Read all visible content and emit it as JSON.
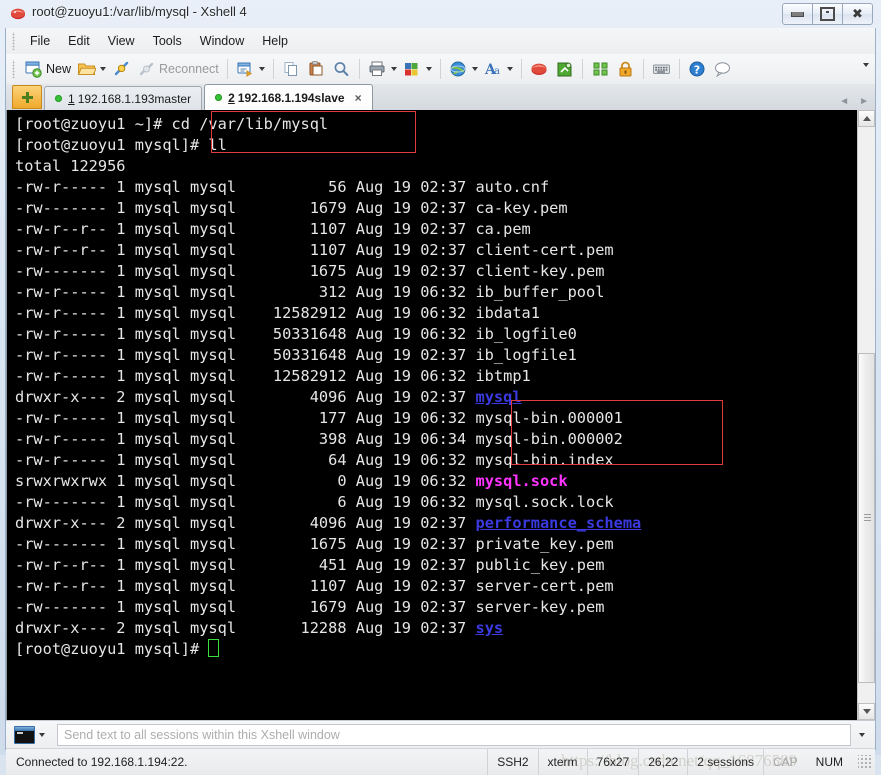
{
  "window": {
    "title": "root@zuoyu1:/var/lib/mysql - Xshell 4",
    "icon": "xshell-logo-icon",
    "controls": {
      "minimize": "minimize-icon",
      "maximize": "restore-icon",
      "close": "close-icon"
    }
  },
  "menubar": {
    "items": [
      "File",
      "Edit",
      "View",
      "Tools",
      "Window",
      "Help"
    ]
  },
  "toolbar": {
    "new_label": "New",
    "reconnect_label": "Reconnect",
    "items": [
      {
        "name": "new-session-button",
        "icon": "new-window-icon",
        "label": "New"
      },
      {
        "name": "open-sessions-button",
        "icon": "open-folder-icon",
        "label": "",
        "caret": true
      },
      {
        "name": "connect-button",
        "icon": "connect-plug-icon",
        "label": ""
      },
      {
        "name": "reconnect-button",
        "icon": "disconnected-plug-icon",
        "label": "Reconnect",
        "disabled": true
      },
      {
        "name": "transfer-file-button",
        "icon": "file-transfer-icon",
        "label": "",
        "caret": true
      },
      {
        "name": "copy-button",
        "icon": "copy-icon",
        "label": ""
      },
      {
        "name": "paste-button",
        "icon": "paste-icon",
        "label": ""
      },
      {
        "name": "find-button",
        "icon": "magnifier-icon",
        "label": ""
      },
      {
        "name": "print-button",
        "icon": "printer-icon",
        "label": "",
        "caret": true
      },
      {
        "name": "layout-button",
        "icon": "color-blocks-icon",
        "label": "",
        "caret": true
      },
      {
        "name": "web-button",
        "icon": "globe-icon",
        "label": "",
        "caret": true
      },
      {
        "name": "font-button",
        "icon": "font-A-icon",
        "label": "",
        "caret": true
      },
      {
        "name": "xshell-button",
        "icon": "xshell-logo-icon",
        "label": ""
      },
      {
        "name": "xftp-button",
        "icon": "xftp-green-icon",
        "label": ""
      },
      {
        "name": "fullscreen-button",
        "icon": "fullscreen-arrows-icon",
        "label": ""
      },
      {
        "name": "lock-button",
        "icon": "lock-icon",
        "label": ""
      },
      {
        "name": "keyboard-button",
        "icon": "keyboard-icon",
        "label": ""
      },
      {
        "name": "help-button",
        "icon": "question-mark-icon",
        "label": ""
      },
      {
        "name": "chat-button",
        "icon": "speech-bubble-icon",
        "label": ""
      }
    ]
  },
  "tabbar": {
    "new_tab_icon": "plus-icon",
    "tabs": [
      {
        "index": "1",
        "label": "192.168.1.193master",
        "active": false,
        "status": "connected"
      },
      {
        "index": "2",
        "label": "192.168.1.194slave",
        "active": true,
        "status": "connected",
        "close": "×"
      }
    ],
    "nav_prev": "◄",
    "nav_next": "►"
  },
  "terminal": {
    "lines": [
      {
        "segs": [
          {
            "t": "[root@zuoyu1 ~]# cd /var/lib/mysql",
            "c": "white"
          }
        ]
      },
      {
        "segs": [
          {
            "t": "[root@zuoyu1 mysql]# ll",
            "c": "white"
          }
        ]
      },
      {
        "segs": [
          {
            "t": "total 122956",
            "c": "white"
          }
        ]
      },
      {
        "segs": [
          {
            "t": "-rw-r----- 1 mysql mysql          56 Aug 19 02:37 auto.cnf",
            "c": "white"
          }
        ]
      },
      {
        "segs": [
          {
            "t": "-rw------- 1 mysql mysql        1679 Aug 19 02:37 ca-key.pem",
            "c": "white"
          }
        ]
      },
      {
        "segs": [
          {
            "t": "-rw-r--r-- 1 mysql mysql        1107 Aug 19 02:37 ca.pem",
            "c": "white"
          }
        ]
      },
      {
        "segs": [
          {
            "t": "-rw-r--r-- 1 mysql mysql        1107 Aug 19 02:37 client-cert.pem",
            "c": "white"
          }
        ]
      },
      {
        "segs": [
          {
            "t": "-rw------- 1 mysql mysql        1675 Aug 19 02:37 client-key.pem",
            "c": "white"
          }
        ]
      },
      {
        "segs": [
          {
            "t": "-rw-r----- 1 mysql mysql         312 Aug 19 06:32 ib_buffer_pool",
            "c": "white"
          }
        ]
      },
      {
        "segs": [
          {
            "t": "-rw-r----- 1 mysql mysql    12582912 Aug 19 06:32 ibdata1",
            "c": "white"
          }
        ]
      },
      {
        "segs": [
          {
            "t": "-rw-r----- 1 mysql mysql    50331648 Aug 19 06:32 ib_logfile0",
            "c": "white"
          }
        ]
      },
      {
        "segs": [
          {
            "t": "-rw-r----- 1 mysql mysql    50331648 Aug 19 02:37 ib_logfile1",
            "c": "white"
          }
        ]
      },
      {
        "segs": [
          {
            "t": "-rw-r----- 1 mysql mysql    12582912 Aug 19 06:32 ibtmp1",
            "c": "white"
          }
        ]
      },
      {
        "segs": [
          {
            "t": "drwxr-x--- 2 mysql mysql        4096 Aug 19 02:37 ",
            "c": "white"
          },
          {
            "t": "mysql",
            "c": "blue-dir"
          }
        ]
      },
      {
        "segs": [
          {
            "t": "-rw-r----- 1 mysql mysql         177 Aug 19 06:32 mysql-bin.000001",
            "c": "white"
          }
        ]
      },
      {
        "segs": [
          {
            "t": "-rw-r----- 1 mysql mysql         398 Aug 19 06:34 mysql-bin.000002",
            "c": "white"
          }
        ]
      },
      {
        "segs": [
          {
            "t": "-rw-r----- 1 mysql mysql          64 Aug 19 06:32 mysql-bin.index",
            "c": "white"
          }
        ]
      },
      {
        "segs": [
          {
            "t": "srwxrwxrwx 1 mysql mysql           0 Aug 19 06:32 ",
            "c": "white"
          },
          {
            "t": "mysql.sock",
            "c": "magenta"
          }
        ]
      },
      {
        "segs": [
          {
            "t": "-rw------- 1 mysql mysql           6 Aug 19 06:32 mysql.sock.lock",
            "c": "white"
          }
        ]
      },
      {
        "segs": [
          {
            "t": "drwxr-x--- 2 mysql mysql        4096 Aug 19 02:37 ",
            "c": "white"
          },
          {
            "t": "performance_schema",
            "c": "blue-dir"
          }
        ]
      },
      {
        "segs": [
          {
            "t": "-rw------- 1 mysql mysql        1675 Aug 19 02:37 private_key.pem",
            "c": "white"
          }
        ]
      },
      {
        "segs": [
          {
            "t": "-rw-r--r-- 1 mysql mysql         451 Aug 19 02:37 public_key.pem",
            "c": "white"
          }
        ]
      },
      {
        "segs": [
          {
            "t": "-rw-r--r-- 1 mysql mysql        1107 Aug 19 02:37 server-cert.pem",
            "c": "white"
          }
        ]
      },
      {
        "segs": [
          {
            "t": "-rw------- 1 mysql mysql        1679 Aug 19 02:37 server-key.pem",
            "c": "white"
          }
        ]
      },
      {
        "segs": [
          {
            "t": "drwxr-x--- 2 mysql mysql       12288 Aug 19 02:37 ",
            "c": "white"
          },
          {
            "t": "sys",
            "c": "blue-dir"
          }
        ]
      },
      {
        "segs": [
          {
            "t": "[root@zuoyu1 mysql]# ",
            "c": "white"
          },
          {
            "t": "",
            "c": "cursor"
          }
        ]
      }
    ],
    "colors": {
      "background": "#000000",
      "foreground": "#e6e6e6",
      "directory": "#3a3ae0",
      "socket": "#ff35ff",
      "cursor": "#3ddc3d",
      "annotation": "#e0393e"
    }
  },
  "sendbar": {
    "icon": "terminal-window-icon",
    "placeholder": "Send text to all sessions within this Xshell window",
    "dropdown_icon": "chevron-down-icon"
  },
  "statusbar": {
    "connection": "Connected to 192.168.1.194:22.",
    "protocol": "SSH2",
    "term_type": "xterm",
    "size": "76x27",
    "cursor_pos": "26,22",
    "sessions": "2 sessions",
    "cap": "CAP",
    "num": "NUM"
  },
  "watermark": "https://blog.csdn.net/qq_16876589",
  "scrollbar": {
    "up_icon": "scroll-up-arrow-icon",
    "down_icon": "scroll-down-arrow-icon"
  }
}
